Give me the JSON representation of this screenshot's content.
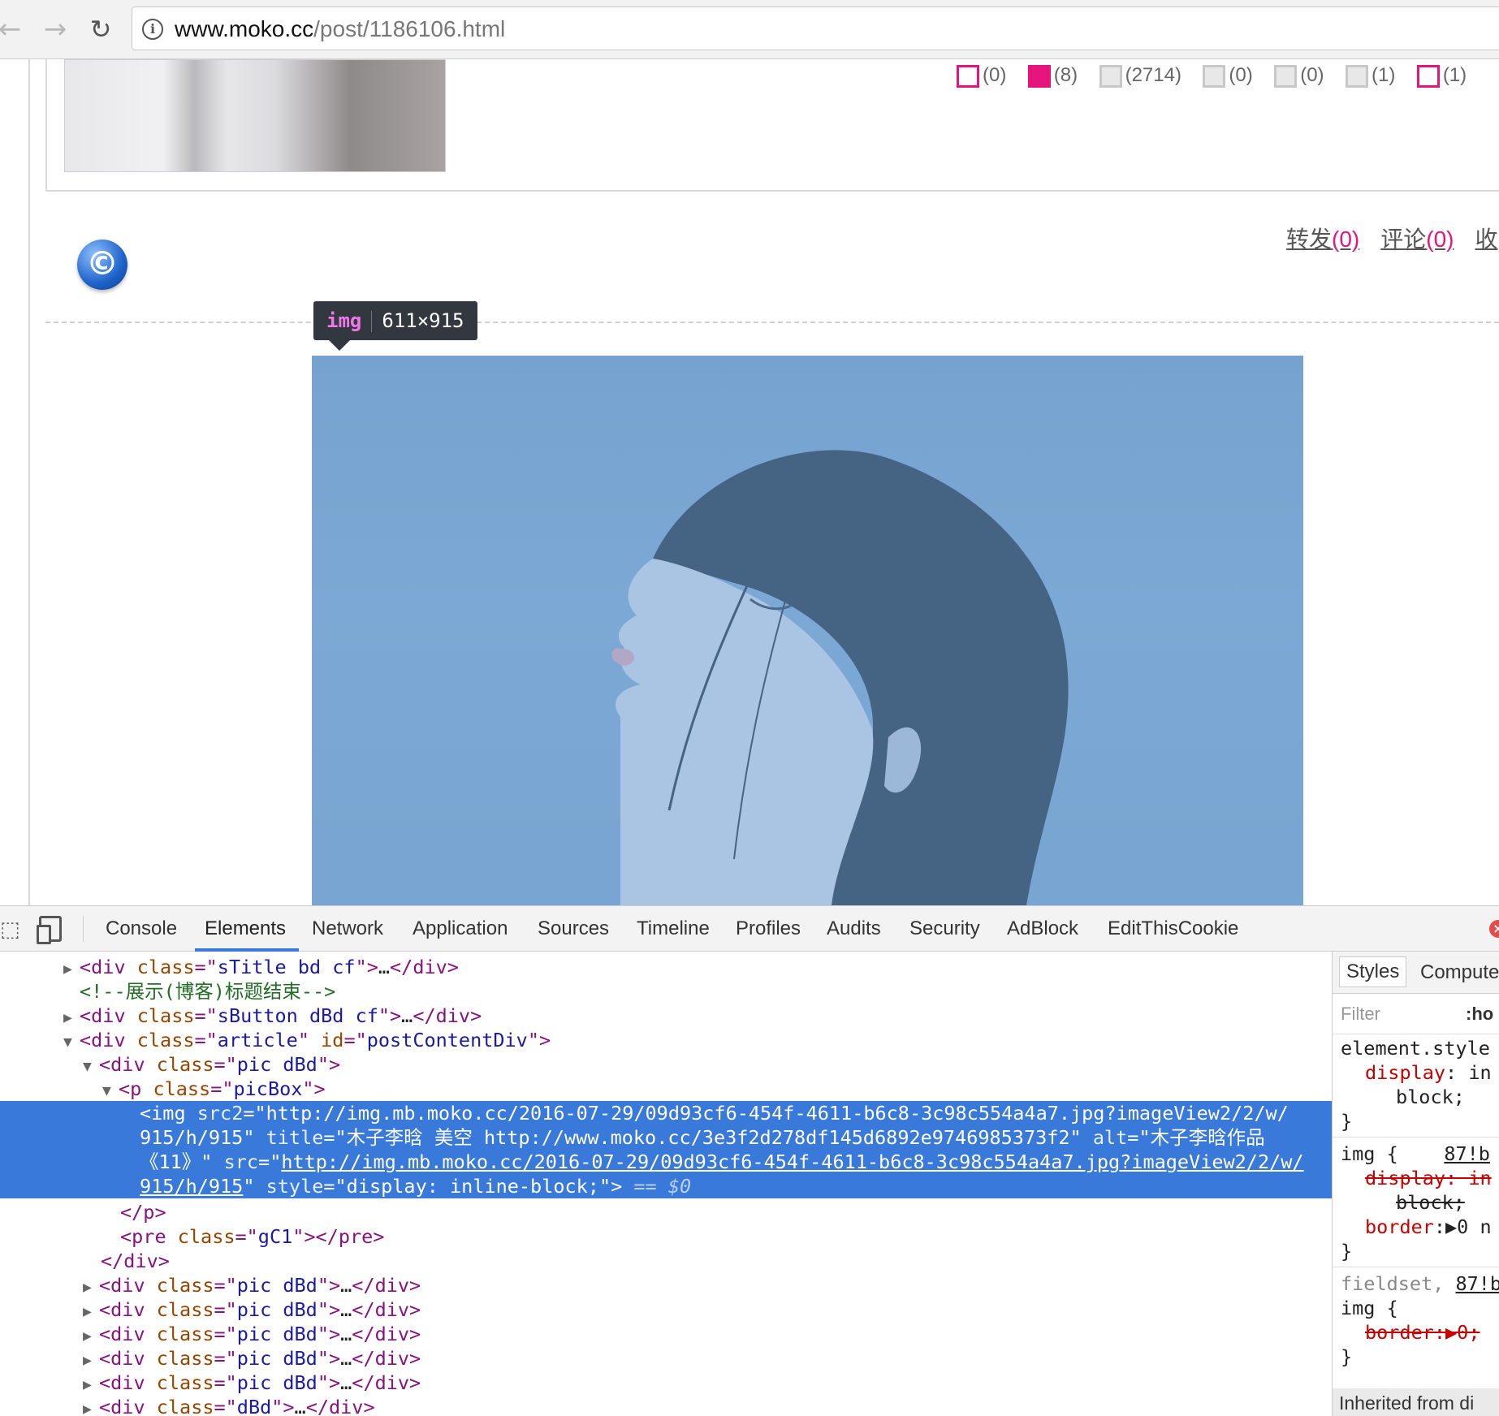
{
  "browser": {
    "back_icon": "back-arrow-icon",
    "forward_icon": "forward-arrow-icon",
    "reload_icon": "reload-icon",
    "url_host": "www.moko.cc",
    "url_path": "/post/1186106.html"
  },
  "page": {
    "stats": [
      {
        "icon": "tv-icon",
        "count": "(0)"
      },
      {
        "icon": "film-icon",
        "count": "(8)"
      },
      {
        "icon": "view-icon",
        "count": "(2714)"
      },
      {
        "icon": "comment-icon",
        "count": "(0)"
      },
      {
        "icon": "share-icon",
        "count": "(0)"
      },
      {
        "icon": "heart-icon",
        "count": "(1)"
      },
      {
        "icon": "recommend-icon",
        "count": "(1)"
      }
    ],
    "share": {
      "label": "转发",
      "count": "(0)"
    },
    "comment": {
      "label": "评论",
      "count": "(0)"
    },
    "collect": {
      "label": "收"
    },
    "tooltip": {
      "tag": "img",
      "size": "611×915"
    }
  },
  "devtools": {
    "tabs": [
      "Console",
      "Elements",
      "Network",
      "Application",
      "Sources",
      "Timeline",
      "Profiles",
      "Audits",
      "Security",
      "AdBlock",
      "EditThisCookie"
    ],
    "active_tab": "Elements",
    "styles_tabs": [
      "Styles",
      "Compute"
    ],
    "filter_placeholder": "Filter",
    "filter_hov": ":ho",
    "inherited": "Inherited from  di"
  },
  "colors": {
    "accent_pink": "#e5157b",
    "devtools_blue": "#3879d9"
  }
}
